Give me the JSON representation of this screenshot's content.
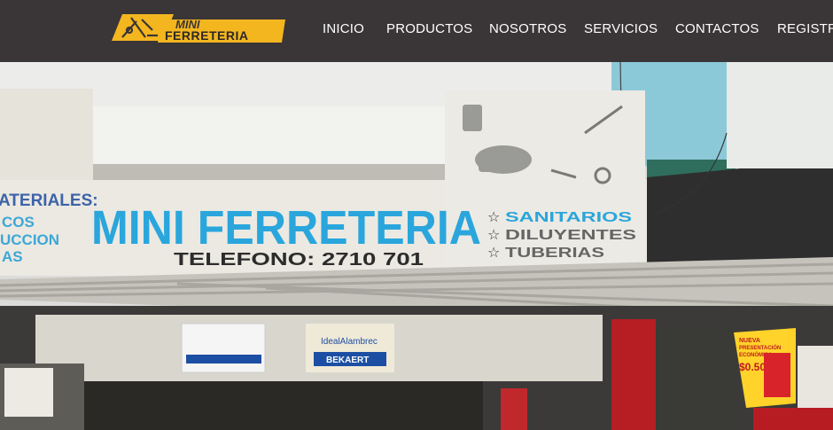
{
  "brand": {
    "logo_line1": "MINI",
    "logo_line2": "FERRETERIA",
    "accent_color": "#f3b61f",
    "icon": "tools-logo-icon"
  },
  "nav": {
    "items": [
      {
        "label": "INICIO"
      },
      {
        "label": "PRODUCTOS"
      },
      {
        "label": "NOSOTROS"
      },
      {
        "label": "SERVICIOS"
      },
      {
        "label": "CONTACTOS"
      },
      {
        "label": "REGISTRA"
      }
    ]
  },
  "hero": {
    "storefront_sign": {
      "left_fragment": [
        "ATERIALES:",
        "COS",
        "UCCION",
        "AS"
      ],
      "title": "MINI FERRETERIA",
      "phone": "TELEFONO: 2710 701",
      "services": [
        "SANITARIOS",
        "DILUYENTES",
        "TUBERIAS"
      ]
    },
    "posters": {
      "brand_sign": "IdealAlambrec",
      "brand_sign2": "BEKAERT",
      "promo_line1": "NUEVA",
      "promo_line2": "PRESENTACIÓN",
      "promo_line3": "ECONÓMICA",
      "promo_price": "$0.50"
    }
  }
}
